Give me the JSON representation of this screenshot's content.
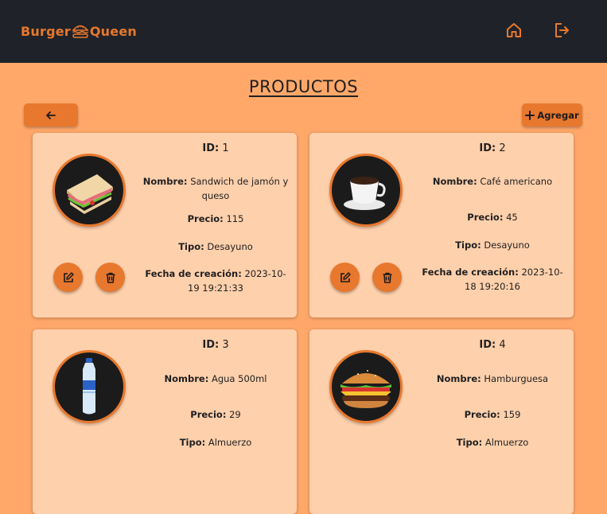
{
  "header": {
    "logo_left": "Burger",
    "logo_right": "Queen",
    "home_icon": "home-icon",
    "logout_icon": "logout-icon"
  },
  "page": {
    "title": "PRODUCTOS",
    "add_label": "Agregar"
  },
  "labels": {
    "id": "ID:",
    "name": "Nombre:",
    "price": "Precio:",
    "type": "Tipo:",
    "date": "Fecha de creación:"
  },
  "products": [
    {
      "id": "1",
      "name": "Sandwich de jamón y queso",
      "price": "115",
      "type": "Desayuno",
      "date": "2023-10-19 19:21:33",
      "image": "sandwich"
    },
    {
      "id": "2",
      "name": "Café americano",
      "price": "45",
      "type": "Desayuno",
      "date": "2023-10-18 19:20:16",
      "image": "coffee"
    },
    {
      "id": "3",
      "name": "Agua 500ml",
      "price": "29",
      "type": "Almuerzo",
      "date": "",
      "image": "water-bottle"
    },
    {
      "id": "4",
      "name": "Hamburguesa",
      "price": "159",
      "type": "Almuerzo",
      "date": "",
      "image": "burger"
    }
  ],
  "colors": {
    "topbar": "#1f2329",
    "background": "#ffa86a",
    "card": "#ffd0ac",
    "accent": "#e8782d"
  }
}
